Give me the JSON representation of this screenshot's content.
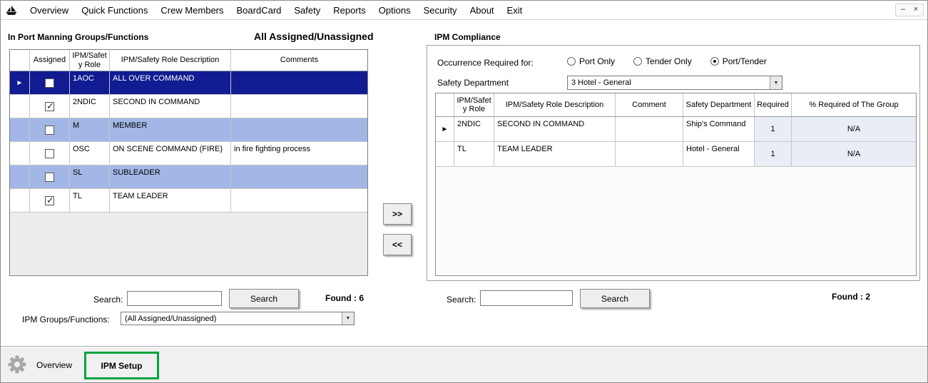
{
  "window": {
    "controls": {
      "minimize": "–",
      "close": "×"
    }
  },
  "menu": {
    "items": [
      "Overview",
      "Quick Functions",
      "Crew Members",
      "BoardCard",
      "Safety",
      "Reports",
      "Options",
      "Security",
      "About",
      "Exit"
    ]
  },
  "left": {
    "title": "In Port Manning Groups/Functions",
    "subtitle": "All Assigned/Unassigned",
    "grid": {
      "headers": {
        "assigned": "Assigned",
        "role": "IPM/Safety Role",
        "description": "IPM/Safety Role Description",
        "comments": "Comments"
      },
      "rows": [
        {
          "assigned": false,
          "role": "1AOC",
          "description": "ALL OVER COMMAND",
          "comments": "",
          "selected": true,
          "highlight": "selected"
        },
        {
          "assigned": true,
          "role": "2NDIC",
          "description": "SECOND IN COMMAND",
          "comments": "",
          "selected": false,
          "highlight": "none"
        },
        {
          "assigned": false,
          "role": "M",
          "description": "MEMBER",
          "comments": "",
          "selected": false,
          "highlight": "blue"
        },
        {
          "assigned": false,
          "role": "OSC",
          "description": "ON SCENE COMMAND (FIRE)",
          "comments": "in fire fighting process",
          "selected": false,
          "highlight": "none"
        },
        {
          "assigned": false,
          "role": "SL",
          "description": "SUBLEADER",
          "comments": "",
          "selected": false,
          "highlight": "blue"
        },
        {
          "assigned": true,
          "role": "TL",
          "description": "TEAM LEADER",
          "comments": "",
          "selected": false,
          "highlight": "none"
        }
      ]
    },
    "search": {
      "label": "Search:",
      "value": "",
      "button": "Search",
      "found": "Found : 6"
    },
    "groups_filter": {
      "label": "IPM Groups/Functions:",
      "value": "(All Assigned/Unassigned)"
    }
  },
  "transfer": {
    "to_right": ">>",
    "to_left": "<<"
  },
  "right": {
    "title": "IPM Compliance",
    "occurrence": {
      "label": "Occurrence Required for:",
      "options": [
        {
          "label": "Port Only",
          "selected": false
        },
        {
          "label": "Tender Only",
          "selected": false
        },
        {
          "label": "Port/Tender",
          "selected": true
        }
      ]
    },
    "safety_department": {
      "label": "Safety Department",
      "value": "3 Hotel - General"
    },
    "grid": {
      "headers": {
        "role": "IPM/Safety Role",
        "description": "IPM/Safety Role Description",
        "comment": "Comment",
        "department": "Safety Department",
        "required": "Required",
        "pct": "% Required of The Group"
      },
      "rows": [
        {
          "role": "2NDIC",
          "description": "SECOND IN COMMAND",
          "comment": "",
          "department": "Ship's Command",
          "required": "1",
          "pct": "N/A",
          "selected": true
        },
        {
          "role": "TL",
          "description": "TEAM LEADER",
          "comment": "",
          "department": "Hotel - General",
          "required": "1",
          "pct": "N/A",
          "selected": false
        }
      ]
    },
    "search": {
      "label": "Search:",
      "value": "",
      "button": "Search",
      "found": "Found : 2"
    }
  },
  "bottom": {
    "tabs": [
      {
        "label": "Overview",
        "active": false
      },
      {
        "label": "IPM Setup",
        "active": true
      }
    ]
  },
  "icons": {
    "row_selector": "►",
    "dropdown": "▼"
  },
  "colors": {
    "selected_row_bg": "#111c92",
    "highlight_row_bg": "#a2b7e6",
    "active_tab_border": "#00a33e"
  }
}
